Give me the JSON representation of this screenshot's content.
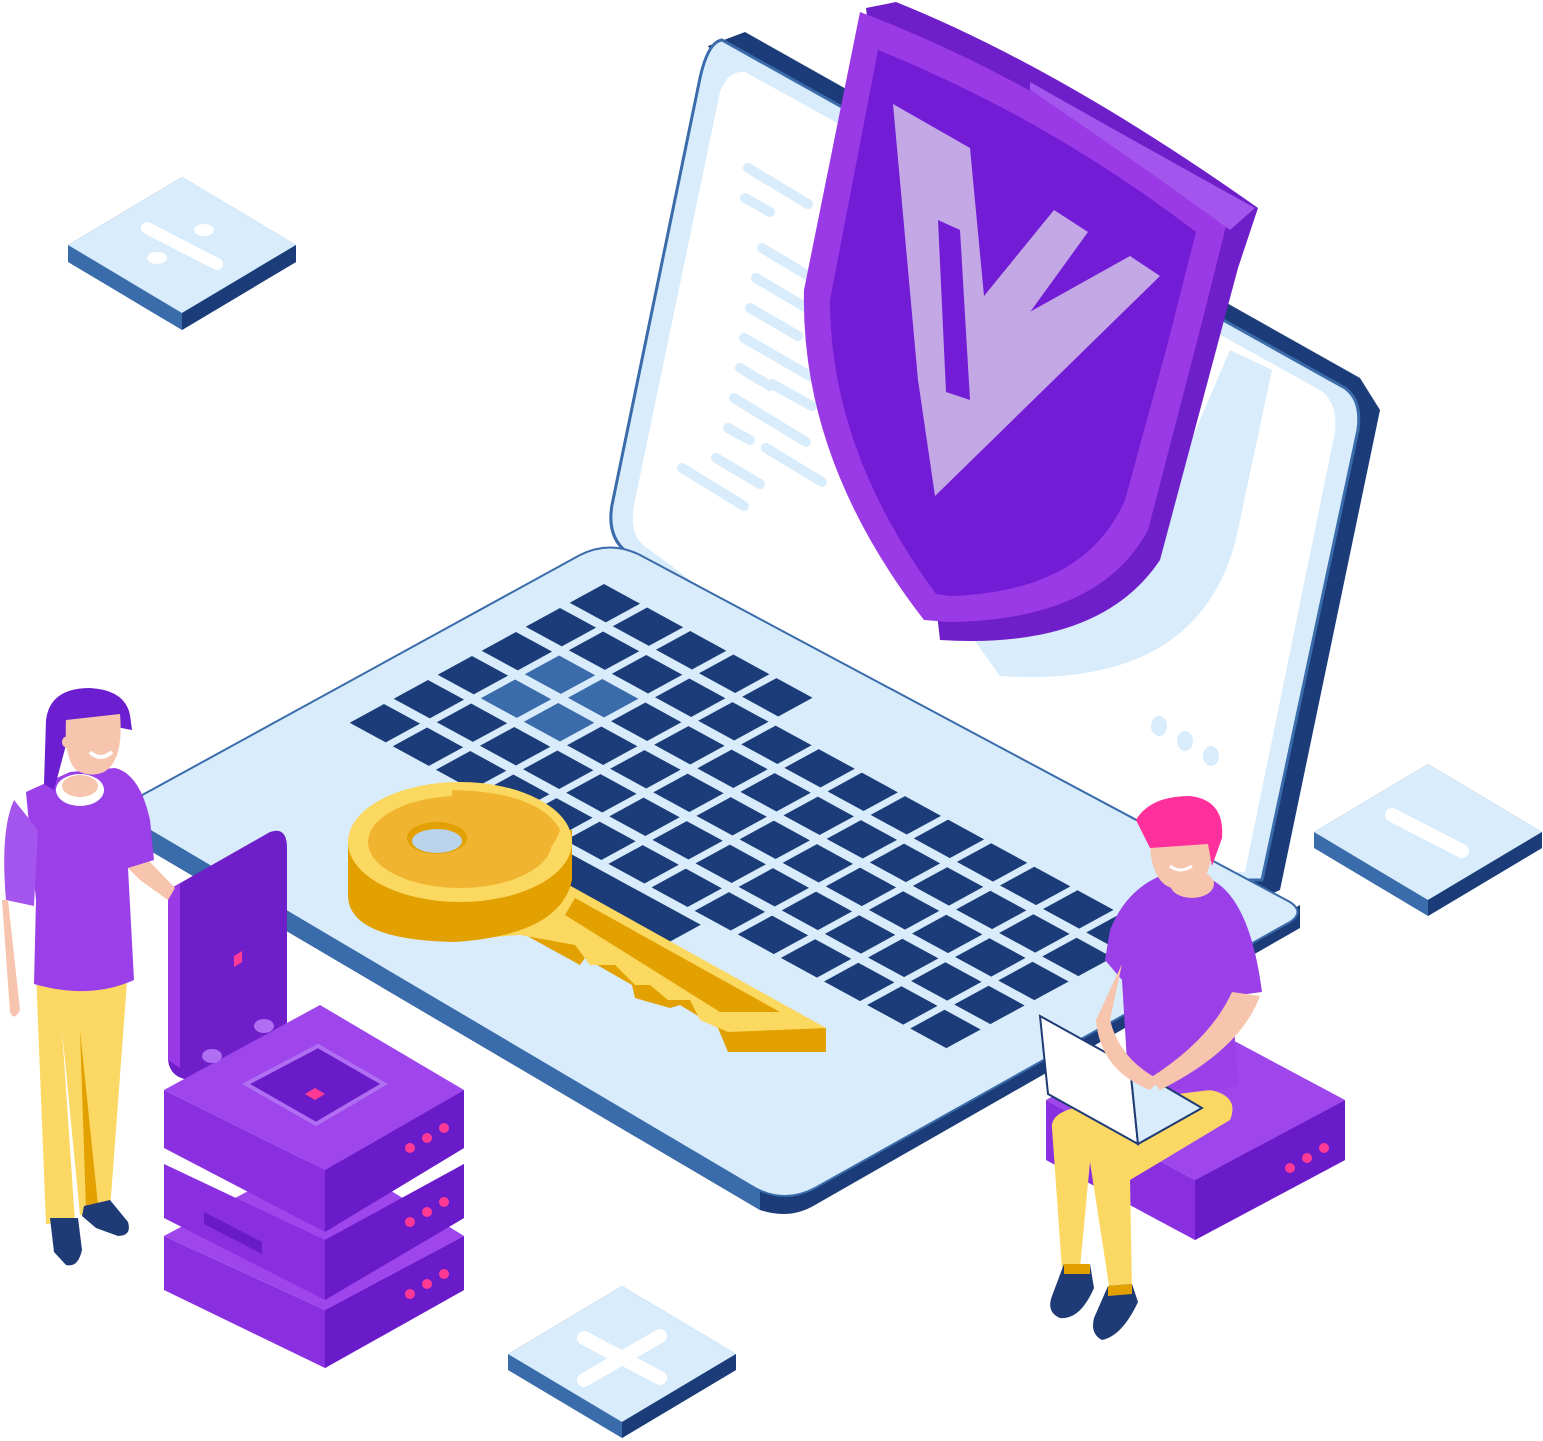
{
  "scene": {
    "type": "isometric-illustration",
    "subject": "cyber-security",
    "elements": {
      "laptop": {
        "icon": "laptop-icon",
        "keys_highlighted": 4
      },
      "shield": {
        "icon": "shield-check-icon"
      },
      "key": {
        "icon": "key-icon"
      },
      "server_stack": {
        "icon": "server-stack-icon",
        "units": 3
      },
      "small_server": {
        "icon": "server-icon",
        "units": 1
      },
      "people": [
        {
          "name": "standing-woman",
          "pose": "standing"
        },
        {
          "name": "sitting-man",
          "pose": "sitting-with-laptop"
        }
      ],
      "floating_tiles": [
        {
          "icon": "divide-icon"
        },
        {
          "icon": "minus-icon"
        },
        {
          "icon": "plus-icon"
        }
      ],
      "typing_indicator_dots": 3
    }
  },
  "colors": {
    "screen": "#d8ecfb",
    "laptop_dark": "#1b3c78",
    "laptop_mid": "#3a6baa",
    "key_dark": "#1b3c78",
    "key_highlight": "#3a6baa",
    "shield_outer": "#9a3ae6",
    "shield_inner": "#731cd6",
    "shield_check": "#c4a8e6",
    "key_gold": "#f0b430",
    "key_gold_light": "#fbd860",
    "key_gold_dark": "#e2a100",
    "server_light": "#9e45ec",
    "server_mid": "#8a2fe0",
    "server_dark": "#6a1bc9",
    "led": "#ff3a95",
    "skin": "#f7c4ad",
    "hair_woman": "#6c1fd1",
    "hair_man": "#ff2f9b",
    "shirt": "#9b3fe8",
    "pants": "#fbd864",
    "shoes": "#1e3b75"
  }
}
